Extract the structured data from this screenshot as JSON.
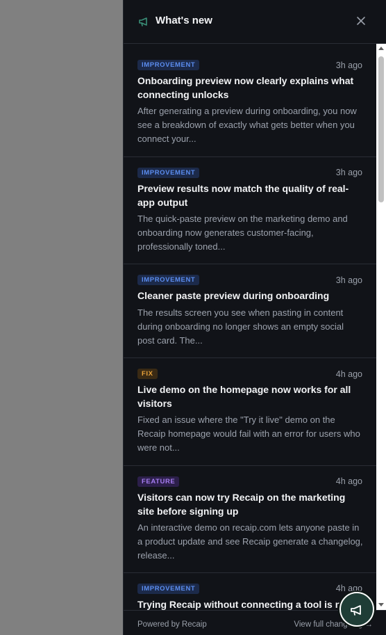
{
  "header": {
    "title": "What's new",
    "icon": "megaphone-icon",
    "close_icon": "close-icon"
  },
  "items": [
    {
      "badge": "IMPROVEMENT",
      "badge_type": "improvement",
      "time": "3h ago",
      "title": "Onboarding preview now clearly explains what connecting unlocks",
      "desc": "After generating a preview during onboarding, you now see a breakdown of exactly what gets better when you connect your..."
    },
    {
      "badge": "IMPROVEMENT",
      "badge_type": "improvement",
      "time": "3h ago",
      "title": "Preview results now match the quality of real-app output",
      "desc": "The quick-paste preview on the marketing demo and onboarding now generates customer-facing, professionally toned..."
    },
    {
      "badge": "IMPROVEMENT",
      "badge_type": "improvement",
      "time": "3h ago",
      "title": "Cleaner paste preview during onboarding",
      "desc": "The results screen you see when pasting in content during onboarding no longer shows an empty social post card. The..."
    },
    {
      "badge": "FIX",
      "badge_type": "fix",
      "time": "4h ago",
      "title": "Live demo on the homepage now works for all visitors",
      "desc": "Fixed an issue where the \"Try it live\" demo on the Recaip homepage would fail with an error for users who were not..."
    },
    {
      "badge": "FEATURE",
      "badge_type": "feature",
      "time": "4h ago",
      "title": "Visitors can now try Recaip on the marketing site before signing up",
      "desc": "An interactive demo on recaip.com lets anyone paste in a product update and see Recaip generate a changelog, release..."
    },
    {
      "badge": "IMPROVEMENT",
      "badge_type": "improvement",
      "time": "4h ago",
      "title": "Trying Recaip without connecting a tool is now",
      "desc": ""
    }
  ],
  "footer": {
    "powered": "Powered by Recaip",
    "view_all": "View full changelog →"
  },
  "colors": {
    "panel_bg": "#111318",
    "overlay": "#808080",
    "improvement": "#5b8def",
    "fix": "#e8a23a",
    "feature": "#a57cf0",
    "fab_bg": "#1f3d36"
  }
}
